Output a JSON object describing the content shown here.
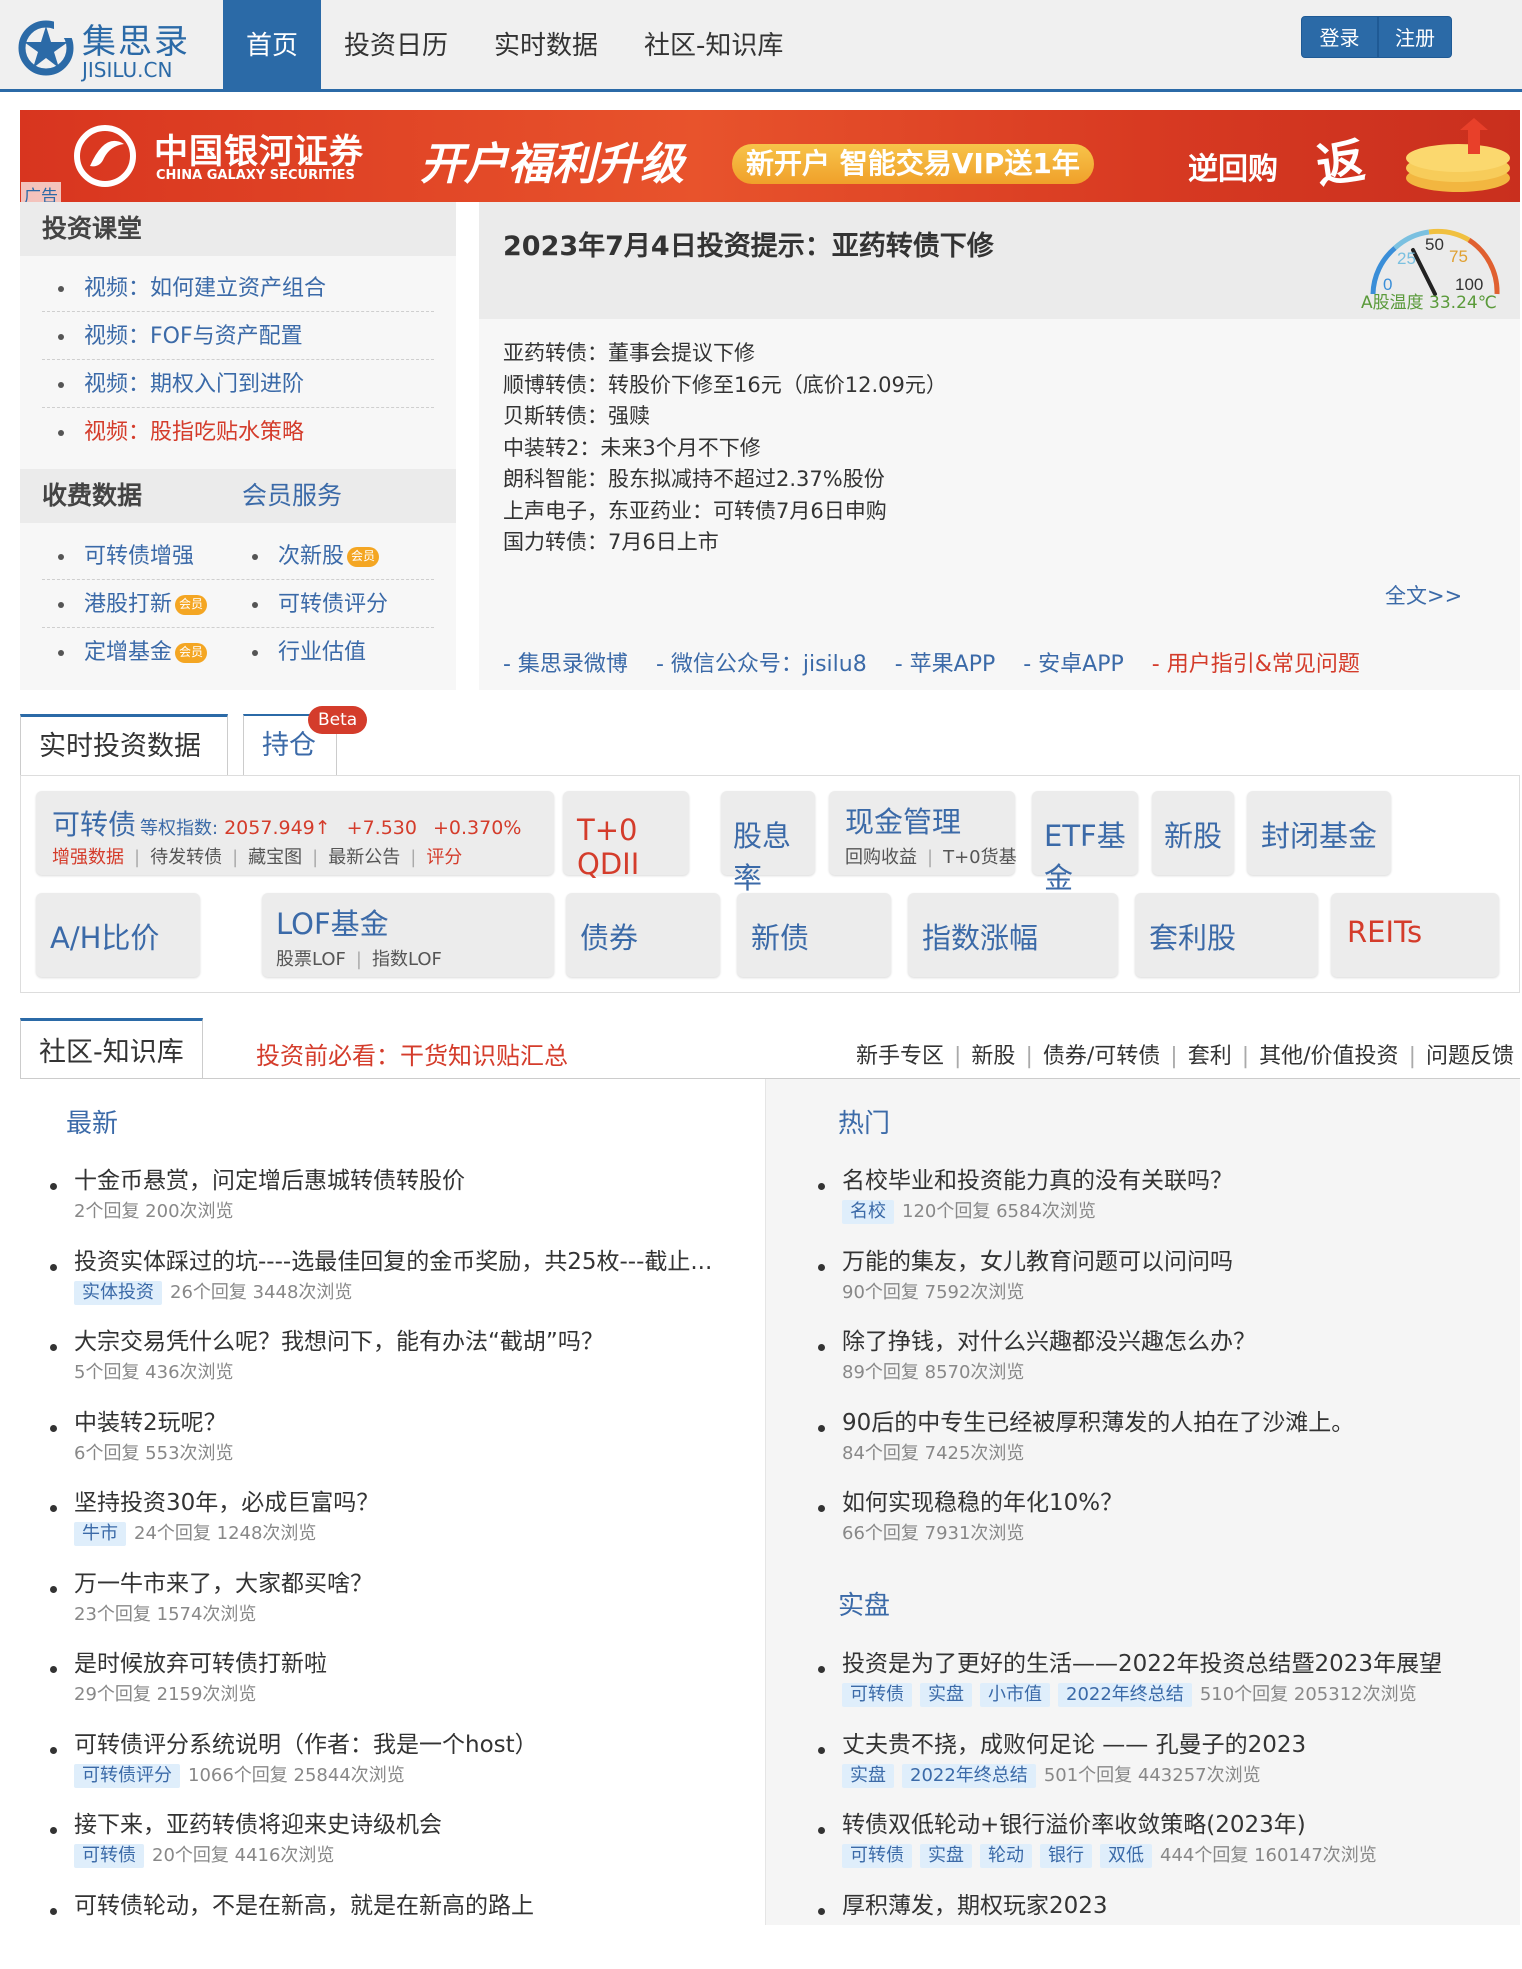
{
  "header": {
    "logo_cn": "集思录",
    "logo_en": "JISILU.CN",
    "nav": [
      "首页",
      "投资日历",
      "实时数据",
      "社区-知识库"
    ],
    "login": "登录",
    "register": "注册"
  },
  "banner": {
    "brand_cn": "中国银河证券",
    "brand_en": "CHINA GALAXY SECURITIES",
    "slogan": "开户福利升级",
    "offer": "新开户  智能交易VIP送1年",
    "extra": "逆回购",
    "extra2": "返",
    "ad_tag": "广告"
  },
  "course": {
    "title": "投资课堂",
    "items": [
      "视频：如何建立资产组合",
      "视频：FOF与资产配置",
      "视频：期权入门到进阶",
      "视频：股指吃贴水策略"
    ]
  },
  "paid": {
    "title": "收费数据",
    "member": "会员服务",
    "vip_label": "会员",
    "items": [
      "可转债增强",
      "次新股",
      "港股打新",
      "可转债评分",
      "定增基金",
      "行业估值"
    ]
  },
  "tip": {
    "title": "2023年7月4日投资提示：亚药转债下修",
    "lines": [
      "亚药转债：董事会提议下修",
      "顺博转债：转股价下修至16元（底价12.09元）",
      "贝斯转债：强赎",
      "中装转2：未来3个月不下修",
      "朗科智能：股东拟减持不超过2.37%股份",
      "上声电子，东亚药业：可转债7月6日申购",
      "国力转债：7月6日上市"
    ],
    "more": "全文>>",
    "gauge_ticks": [
      "0",
      "25",
      "50",
      "75",
      "100"
    ],
    "gauge_label": "A股温度 33.24℃",
    "gauge_value": 33.24,
    "links": [
      "- 集思录微博",
      "- 微信公众号：jisilu8",
      "- 苹果APP",
      "- 安卓APP",
      "- 用户指引&常见问题"
    ]
  },
  "realtime": {
    "tab_active": "实时投资数据",
    "tab2": "持仓",
    "beta": "Beta",
    "cb": {
      "name": "可转债",
      "index_label": "等权指数:",
      "value": "2057.949↑",
      "change": "+7.530",
      "pct": "+0.370%",
      "links": [
        "增强数据",
        "待发转债",
        "藏宝图",
        "最新公告",
        "评分"
      ]
    },
    "t0": "T+0 QDII",
    "div": "股息率",
    "cash": {
      "name": "现金管理",
      "subs": [
        "回购收益",
        "T+0货基"
      ]
    },
    "etf": "ETF基金",
    "ipo": "新股",
    "closed": "封闭基金",
    "ah": "A/H比价",
    "lof": {
      "name": "LOF基金",
      "subs": [
        "股票LOF",
        "指数LOF"
      ]
    },
    "bond": "债券",
    "newbond": "新债",
    "index": "指数涨幅",
    "arb": "套利股",
    "reits": "REITs"
  },
  "community": {
    "tab": "社区-知识库",
    "must": "投资前必看：干货知识贴汇总",
    "cats": [
      "新手专区",
      "新股",
      "债券/可转债",
      "套利",
      "其他/价值投资",
      "问题反馈"
    ],
    "latest_title": "最新",
    "latest": [
      {
        "title": "十金币悬赏，问定增后惠城转债转股价",
        "tags": [],
        "meta": "2个回复 200次浏览"
      },
      {
        "title": "投资实体踩过的坑----选最佳回复的金币奖励，共25枚---截止...",
        "tags": [
          "实体投资"
        ],
        "meta": "26个回复 3448次浏览"
      },
      {
        "title": "大宗交易凭什么呢？我想问下，能有办法“截胡”吗？",
        "tags": [],
        "meta": "5个回复 436次浏览"
      },
      {
        "title": "中装转2玩呢？",
        "tags": [],
        "meta": "6个回复 553次浏览"
      },
      {
        "title": "坚持投资30年，必成巨富吗？",
        "tags": [
          "牛市"
        ],
        "meta": "24个回复 1248次浏览"
      },
      {
        "title": "万一牛市来了，大家都买啥？",
        "tags": [],
        "meta": "23个回复 1574次浏览"
      },
      {
        "title": "是时候放弃可转债打新啦",
        "tags": [],
        "meta": "29个回复 2159次浏览"
      },
      {
        "title": "可转债评分系统说明（作者：我是一个host）",
        "tags": [
          "可转债评分"
        ],
        "meta": "1066个回复 25844次浏览"
      },
      {
        "title": "接下来，亚药转债将迎来史诗级机会",
        "tags": [
          "可转债"
        ],
        "meta": "20个回复 4416次浏览"
      },
      {
        "title": "可转债轮动，不是在新高，就是在新高的路上",
        "tags": [],
        "meta": ""
      }
    ],
    "hot_title": "热门",
    "hot": [
      {
        "title": "名校毕业和投资能力真的没有关联吗？",
        "tags": [
          "名校"
        ],
        "meta": "120个回复 6584次浏览"
      },
      {
        "title": "万能的集友，女儿教育问题可以问问吗",
        "tags": [],
        "meta": "90个回复 7592次浏览"
      },
      {
        "title": "除了挣钱，对什么兴趣都没兴趣怎么办？",
        "tags": [],
        "meta": "89个回复 8570次浏览"
      },
      {
        "title": "90后的中专生已经被厚积薄发的人拍在了沙滩上。",
        "tags": [],
        "meta": "84个回复 7425次浏览"
      },
      {
        "title": "如何实现稳稳的年化10%？",
        "tags": [],
        "meta": "66个回复 7931次浏览"
      }
    ],
    "real_title": "实盘",
    "real": [
      {
        "title": "投资是为了更好的生活——2022年投资总结暨2023年展望",
        "tags": [
          "可转债",
          "实盘",
          "小市值",
          "2022年终总结"
        ],
        "meta": "510个回复 205312次浏览"
      },
      {
        "title": "丈夫贵不挠，成败何足论 —— 孔曼子的2023",
        "tags": [
          "实盘",
          "2022年终总结"
        ],
        "meta": "501个回复 443257次浏览"
      },
      {
        "title": "转债双低轮动+银行溢价率收敛策略(2023年)",
        "tags": [
          "可转债",
          "实盘",
          "轮动",
          "银行",
          "双低"
        ],
        "meta": "444个回复 160147次浏览"
      },
      {
        "title": "厚积薄发，期权玩家2023",
        "tags": [],
        "meta": ""
      }
    ]
  },
  "colors": {
    "brand": "#2b6aa7",
    "link": "#3b6aa8",
    "red": "#d43c2b",
    "vip": "#f4a623",
    "tag_bg": "#dfeefb"
  }
}
